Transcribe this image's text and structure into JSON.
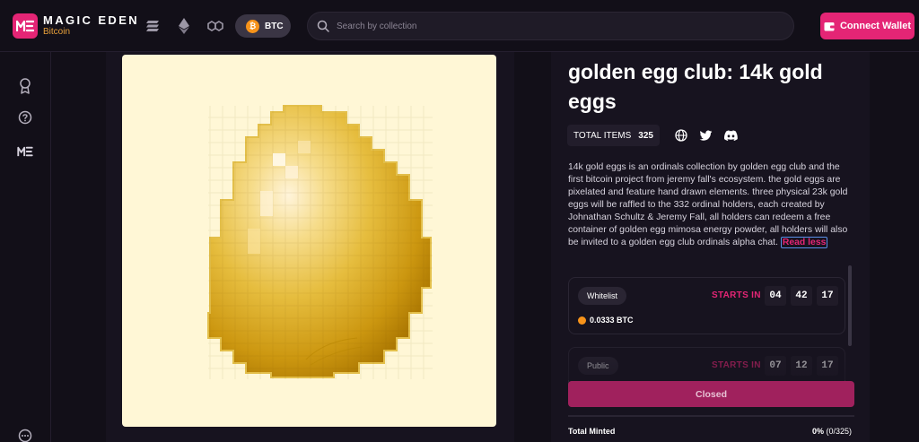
{
  "app": {
    "logo_main": "MAGIC EDEN",
    "logo_sub": "Bitcoin",
    "logo_icon": "magic-eden-logo"
  },
  "header": {
    "chains": [
      "solana",
      "ethereum",
      "polygon"
    ],
    "active_chain_label": "BTC",
    "search_placeholder": "Search by collection",
    "connect_label": "Connect Wallet"
  },
  "sidebar": {
    "items": [
      "award-icon",
      "help-icon",
      "magic-eden-icon"
    ],
    "bottom_item": "more-icon"
  },
  "collection": {
    "title": "golden egg club: 14k gold eggs",
    "total_items_label": "TOTAL ITEMS",
    "total_items_value": "325",
    "socials": [
      "website",
      "twitter",
      "discord"
    ],
    "description": "14k gold eggs is an ordinals collection by golden egg club and the first bitcoin project from jeremy fall's ecosystem. the gold eggs are pixelated and feature hand drawn elements. three physical 23k gold eggs will be raffled to the 332 ordinal holders, each created by Johnathan Schultz & Jeremy Fall, all holders can redeem a free container of golden egg mimosa energy powder, all holders will also be invited to a golden egg club ordinals alpha chat.",
    "read_less_label": "Read less"
  },
  "phases": [
    {
      "name": "Whitelist",
      "starts_label": "STARTS IN",
      "countdown": [
        "04",
        "42",
        "17"
      ],
      "price": "0.0333 BTC"
    },
    {
      "name": "Public",
      "starts_label": "STARTS IN",
      "countdown": [
        "07",
        "12",
        "17"
      ]
    }
  ],
  "mint": {
    "button_label": "Closed",
    "total_minted_label": "Total Minted",
    "percent": "0%",
    "count": "(0/325)",
    "progress_fraction": 0
  },
  "colors": {
    "accent": "#e42575",
    "background": "#120f18",
    "panel": "#17131f",
    "artwork_bg": "#fff7d6",
    "bitcoin": "#f7931a"
  }
}
